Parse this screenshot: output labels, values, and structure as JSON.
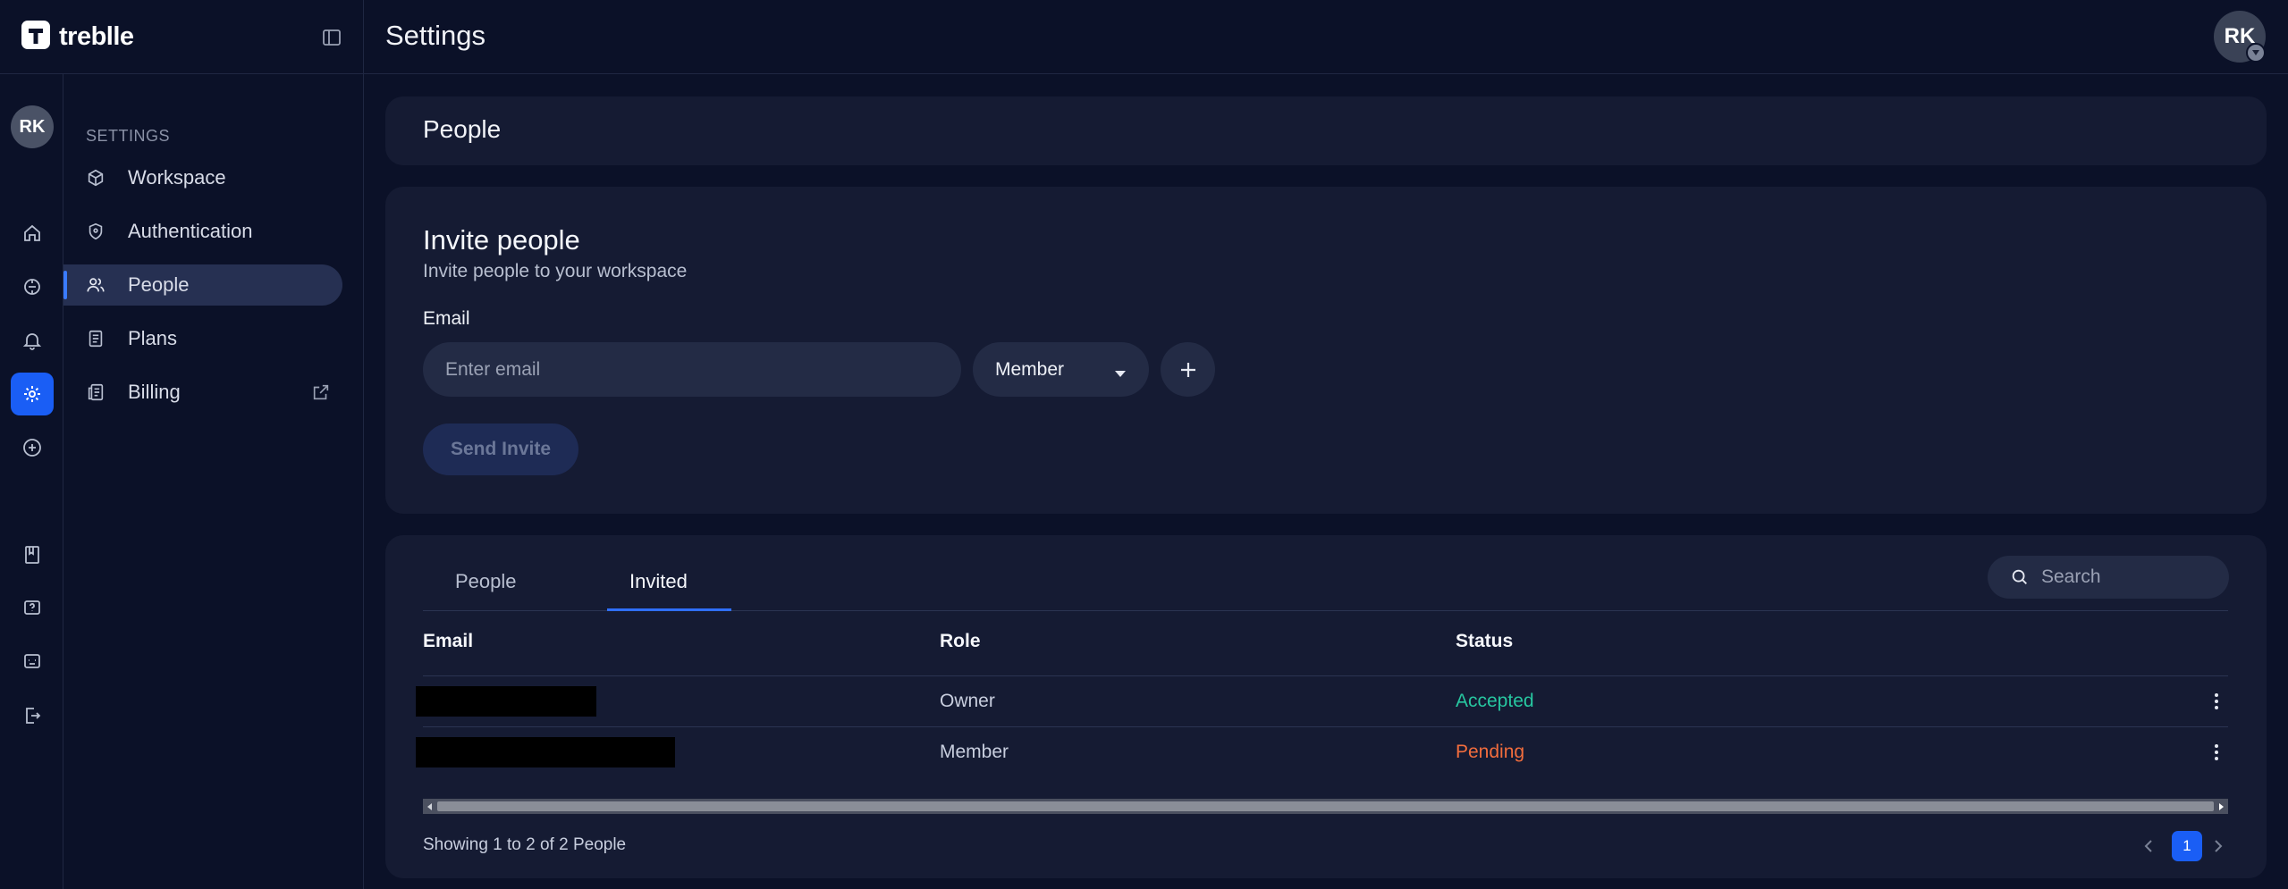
{
  "app": {
    "logo_text": "treblle"
  },
  "header": {
    "title": "Settings",
    "user_initials": "RK"
  },
  "rail": {
    "avatar_initials": "RK"
  },
  "sidebar": {
    "heading": "SETTINGS",
    "items": [
      {
        "label": "Workspace"
      },
      {
        "label": "Authentication"
      },
      {
        "label": "People"
      },
      {
        "label": "Plans"
      },
      {
        "label": "Billing"
      }
    ]
  },
  "people_card": {
    "title": "People"
  },
  "invite": {
    "title": "Invite people",
    "subtitle": "Invite people to your workspace",
    "email_label": "Email",
    "email_placeholder": "Enter email",
    "role_value": "Member",
    "send_label": "Send Invite"
  },
  "table": {
    "tabs": [
      "People",
      "Invited"
    ],
    "active_tab": "Invited",
    "search_placeholder": "Search",
    "columns": [
      "Email",
      "Role",
      "Status"
    ],
    "rows": [
      {
        "role": "Owner",
        "status": "Accepted"
      },
      {
        "role": "Member",
        "status": "Pending"
      }
    ],
    "footer": "Showing 1 to 2 of 2 People",
    "current_page": "1"
  },
  "colors": {
    "accent": "#1a5ef5",
    "accepted": "#27c7a0",
    "pending": "#f26d3d"
  }
}
